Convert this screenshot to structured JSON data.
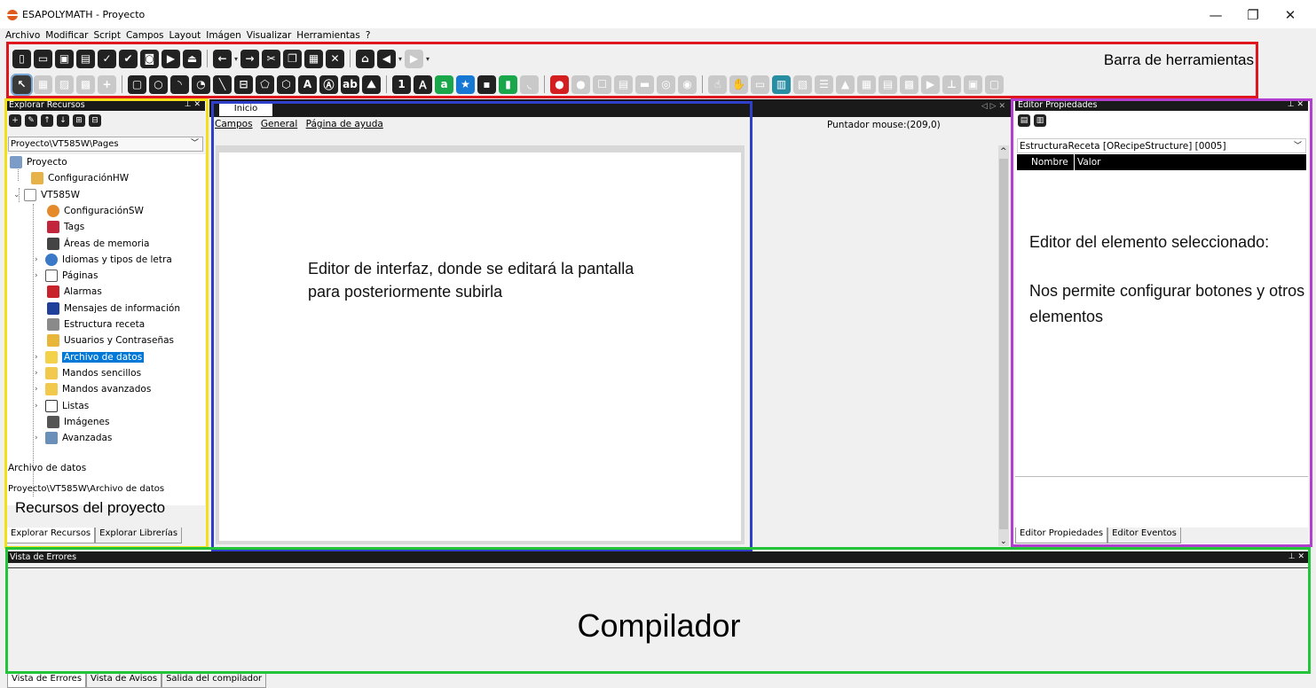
{
  "window": {
    "title": "ESAPOLYMATH - Proyecto",
    "controls": {
      "minimize": "—",
      "restore": "❐",
      "close": "✕"
    }
  },
  "menu": [
    "Archivo",
    "Modificar",
    "Script",
    "Campos",
    "Layout",
    "Imágen",
    "Visualizar",
    "Herramientas",
    "?"
  ],
  "toolbar": {
    "annotation": "Barra de herramientas"
  },
  "resources_panel": {
    "header": "Explorar Recursos",
    "pin": "⊥ ✕",
    "path": "Proyecto\\VT585W\\Pages",
    "tree": {
      "root": "Proyecto",
      "hw": "ConfiguraciónHW",
      "device": "VT585W",
      "items": [
        "ConfiguraciónSW",
        "Tags",
        "Áreas de memoria",
        "Idiomas y tipos de letra",
        "Páginas",
        "Alarmas",
        "Mensajes de información",
        "Estructura receta",
        "Usuarios y Contraseñas",
        "Archivo de datos",
        "Mandos sencillos",
        "Mandos avanzados",
        "Listas",
        "Imágenes",
        "Avanzadas"
      ],
      "selected": "Archivo de datos"
    },
    "info_title": "Archivo de datos",
    "info_path": "Proyecto\\VT585W\\Archivo de datos",
    "annotation": "Recursos del proyecto",
    "tabs": [
      "Explorar Recursos",
      "Explorar Librerías"
    ]
  },
  "editor": {
    "tab": "Inicio",
    "subtabs": [
      "Campos",
      "General",
      "Página de ayuda"
    ],
    "mouse": "Puntador mouse:(209,0)",
    "annotation": "Editor de interfaz, donde se editará la pantalla para posteriormente subirla"
  },
  "properties_panel": {
    "header": "Editor Propiedades",
    "object": "EstructuraReceta [ORecipeStructure] [0005]",
    "col_name": "Nombre",
    "col_value": "Valor",
    "annotation_title": "Editor del elemento seleccionado:",
    "annotation_body": "Nos permite configurar botones y otros elementos",
    "tabs": [
      "Editor Propiedades",
      "Editor Eventos"
    ]
  },
  "errors_panel": {
    "header": "Vista de Errores",
    "annotation": "Compilador",
    "tabs": [
      "Vista de Errores",
      "Vista de Avisos",
      "Salida del compilador"
    ]
  },
  "colors": {
    "toolbar_box": "#e0161f",
    "resources_box": "#f2e11a",
    "editor_box": "#2f3fc8",
    "properties_box": "#b23fd0",
    "compiler_box": "#22c43a",
    "selection": "#0078d7"
  }
}
